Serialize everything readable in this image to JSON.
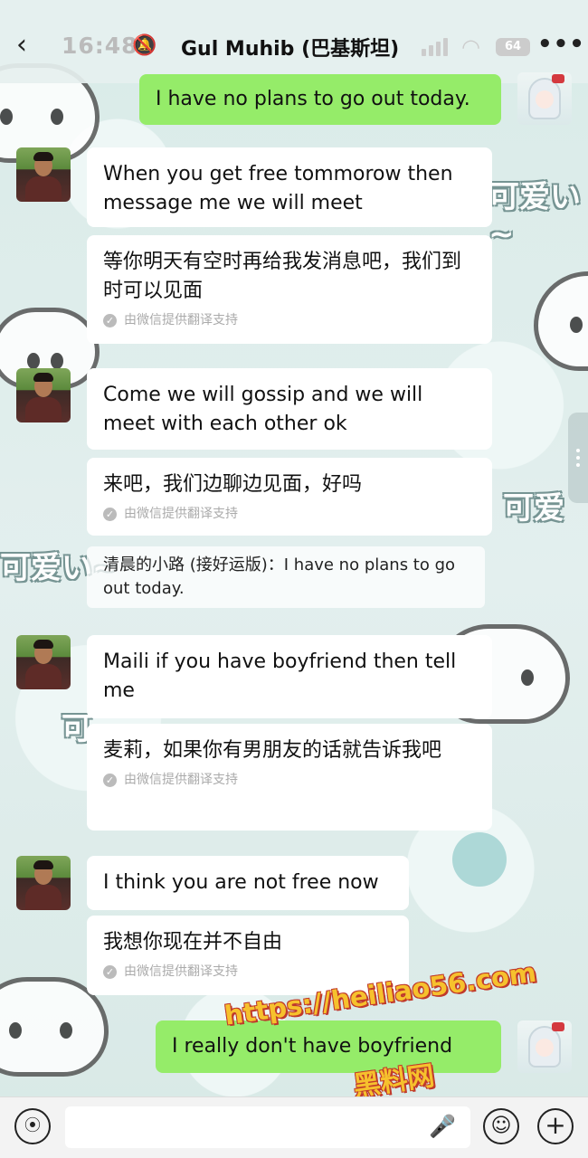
{
  "status_bar": {
    "time": "16:48",
    "battery": "64"
  },
  "header": {
    "back_icon": "chevron-left-icon",
    "title": "Gul Muhib (巴基斯坦)",
    "more_icon": "more-dots-icon"
  },
  "messages": [
    {
      "id": "m1",
      "direction": "sent",
      "text": "I have no plans to go out today."
    },
    {
      "id": "m2",
      "direction": "received",
      "text": "When you get free tommorow then message me we will meet",
      "translation": "等你明天有空时再给我发消息吧，我们到时可以见面",
      "translation_note": "由微信提供翻译支持"
    },
    {
      "id": "m3",
      "direction": "received",
      "text": "Come we will gossip and we will meet with each other ok",
      "translation": "来吧，我们边聊边见面，好吗",
      "translation_note": "由微信提供翻译支持"
    },
    {
      "id": "m4",
      "direction": "quote",
      "text": "清晨的小路 (接好运版)：I have no plans to go out today."
    },
    {
      "id": "m5",
      "direction": "received",
      "text": "Maili if you have boyfriend then tell me",
      "translation": "麦莉，如果你有男朋友的话就告诉我吧",
      "translation_note": "由微信提供翻译支持"
    },
    {
      "id": "m6",
      "direction": "received",
      "text": "I think you are not free now",
      "translation": "我想你现在并不自由",
      "translation_note": "由微信提供翻译支持"
    },
    {
      "id": "m7",
      "direction": "sent",
      "text": "I really don't have boyfriend"
    }
  ],
  "wallpaper": {
    "sticker_text_1": "可爱い~",
    "sticker_text_2": "可爱",
    "sticker_text_3": "可爱い~",
    "sticker_text_4": "可"
  },
  "watermark": {
    "url": "https://heiliao56.com",
    "site_name": "黑料网"
  },
  "input_bar": {
    "voice_icon": "voice-icon",
    "emoji_icon": "emoji-icon",
    "plus_icon": "plus-icon",
    "placeholder": ""
  },
  "colors": {
    "sent_bubble": "#95ec69",
    "received_bubble": "#ffffff",
    "background": "#dcecea"
  }
}
